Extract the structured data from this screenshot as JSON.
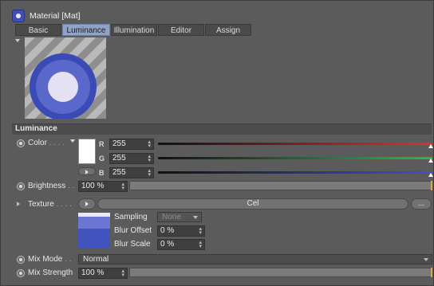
{
  "window": {
    "title": "Material [Mat]"
  },
  "tabs": [
    {
      "label": "Basic",
      "active": false
    },
    {
      "label": "Luminance",
      "active": true
    },
    {
      "label": "Illumination",
      "active": false
    },
    {
      "label": "Editor",
      "active": false
    },
    {
      "label": "Assign",
      "active": false
    }
  ],
  "preview": {
    "icon": "material-sphere-preview"
  },
  "section": {
    "title": "Luminance"
  },
  "color": {
    "label": "Color",
    "dots": " . . . .",
    "swatch_hex": "#ffffff",
    "channels": [
      {
        "name": "R",
        "value": "255",
        "bar_color": "#e03030"
      },
      {
        "name": "G",
        "value": "255",
        "bar_color": "#35b54a"
      },
      {
        "name": "B",
        "value": "255",
        "bar_color": "#3a55c8"
      }
    ]
  },
  "brightness": {
    "label": "Brightness",
    "dots": " . .",
    "value": "100 %",
    "fraction": 1.0
  },
  "texture": {
    "label": "Texture",
    "dots": " . . . .",
    "shader_name": "Cel",
    "more_button": "...",
    "sampling_label": "Sampling",
    "sampling_value": "None",
    "blur_offset_label": "Blur Offset",
    "blur_offset_value": "0 %",
    "blur_scale_label": "Blur Scale",
    "blur_scale_value": "0 %"
  },
  "mix_mode": {
    "label": "Mix Mode",
    "dots": " . .",
    "value": "Normal"
  },
  "mix_strength": {
    "label": "Mix Strength",
    "value": "100 %",
    "fraction": 1.0
  },
  "colors": {
    "accent": "#8fa3c6",
    "slider_end": "#e0a24b",
    "material_blue": "#3f4fb8"
  }
}
